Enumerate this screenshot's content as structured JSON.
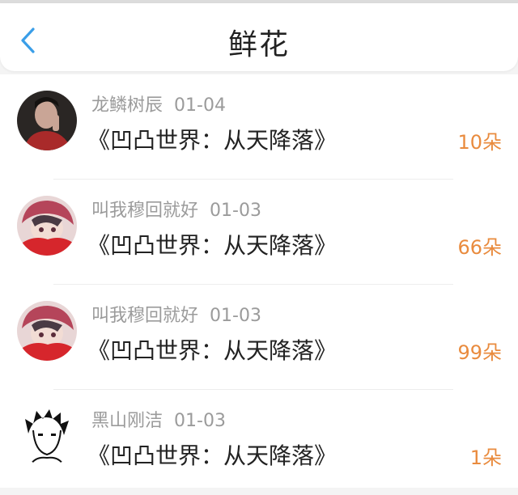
{
  "header": {
    "title": "鲜花",
    "back_icon": "chevron-left-icon",
    "accent_color": "#3a9ee8"
  },
  "count_color": "#e98b3e",
  "items": [
    {
      "user": "龙鳞树辰",
      "date": "01-04",
      "book": "《凹凸世界：从天降落》",
      "count": "10朵",
      "avatar": "photo-avatar"
    },
    {
      "user": "叫我穆回就好",
      "date": "01-03",
      "book": "《凹凸世界：从天降落》",
      "count": "66朵",
      "avatar": "anime-avatar"
    },
    {
      "user": "叫我穆回就好",
      "date": "01-03",
      "book": "《凹凸世界：从天降落》",
      "count": "99朵",
      "avatar": "anime-avatar"
    },
    {
      "user": "黑山刚洁",
      "date": "01-03",
      "book": "《凹凸世界：从天降落》",
      "count": "1朵",
      "avatar": "sketch-avatar"
    }
  ]
}
